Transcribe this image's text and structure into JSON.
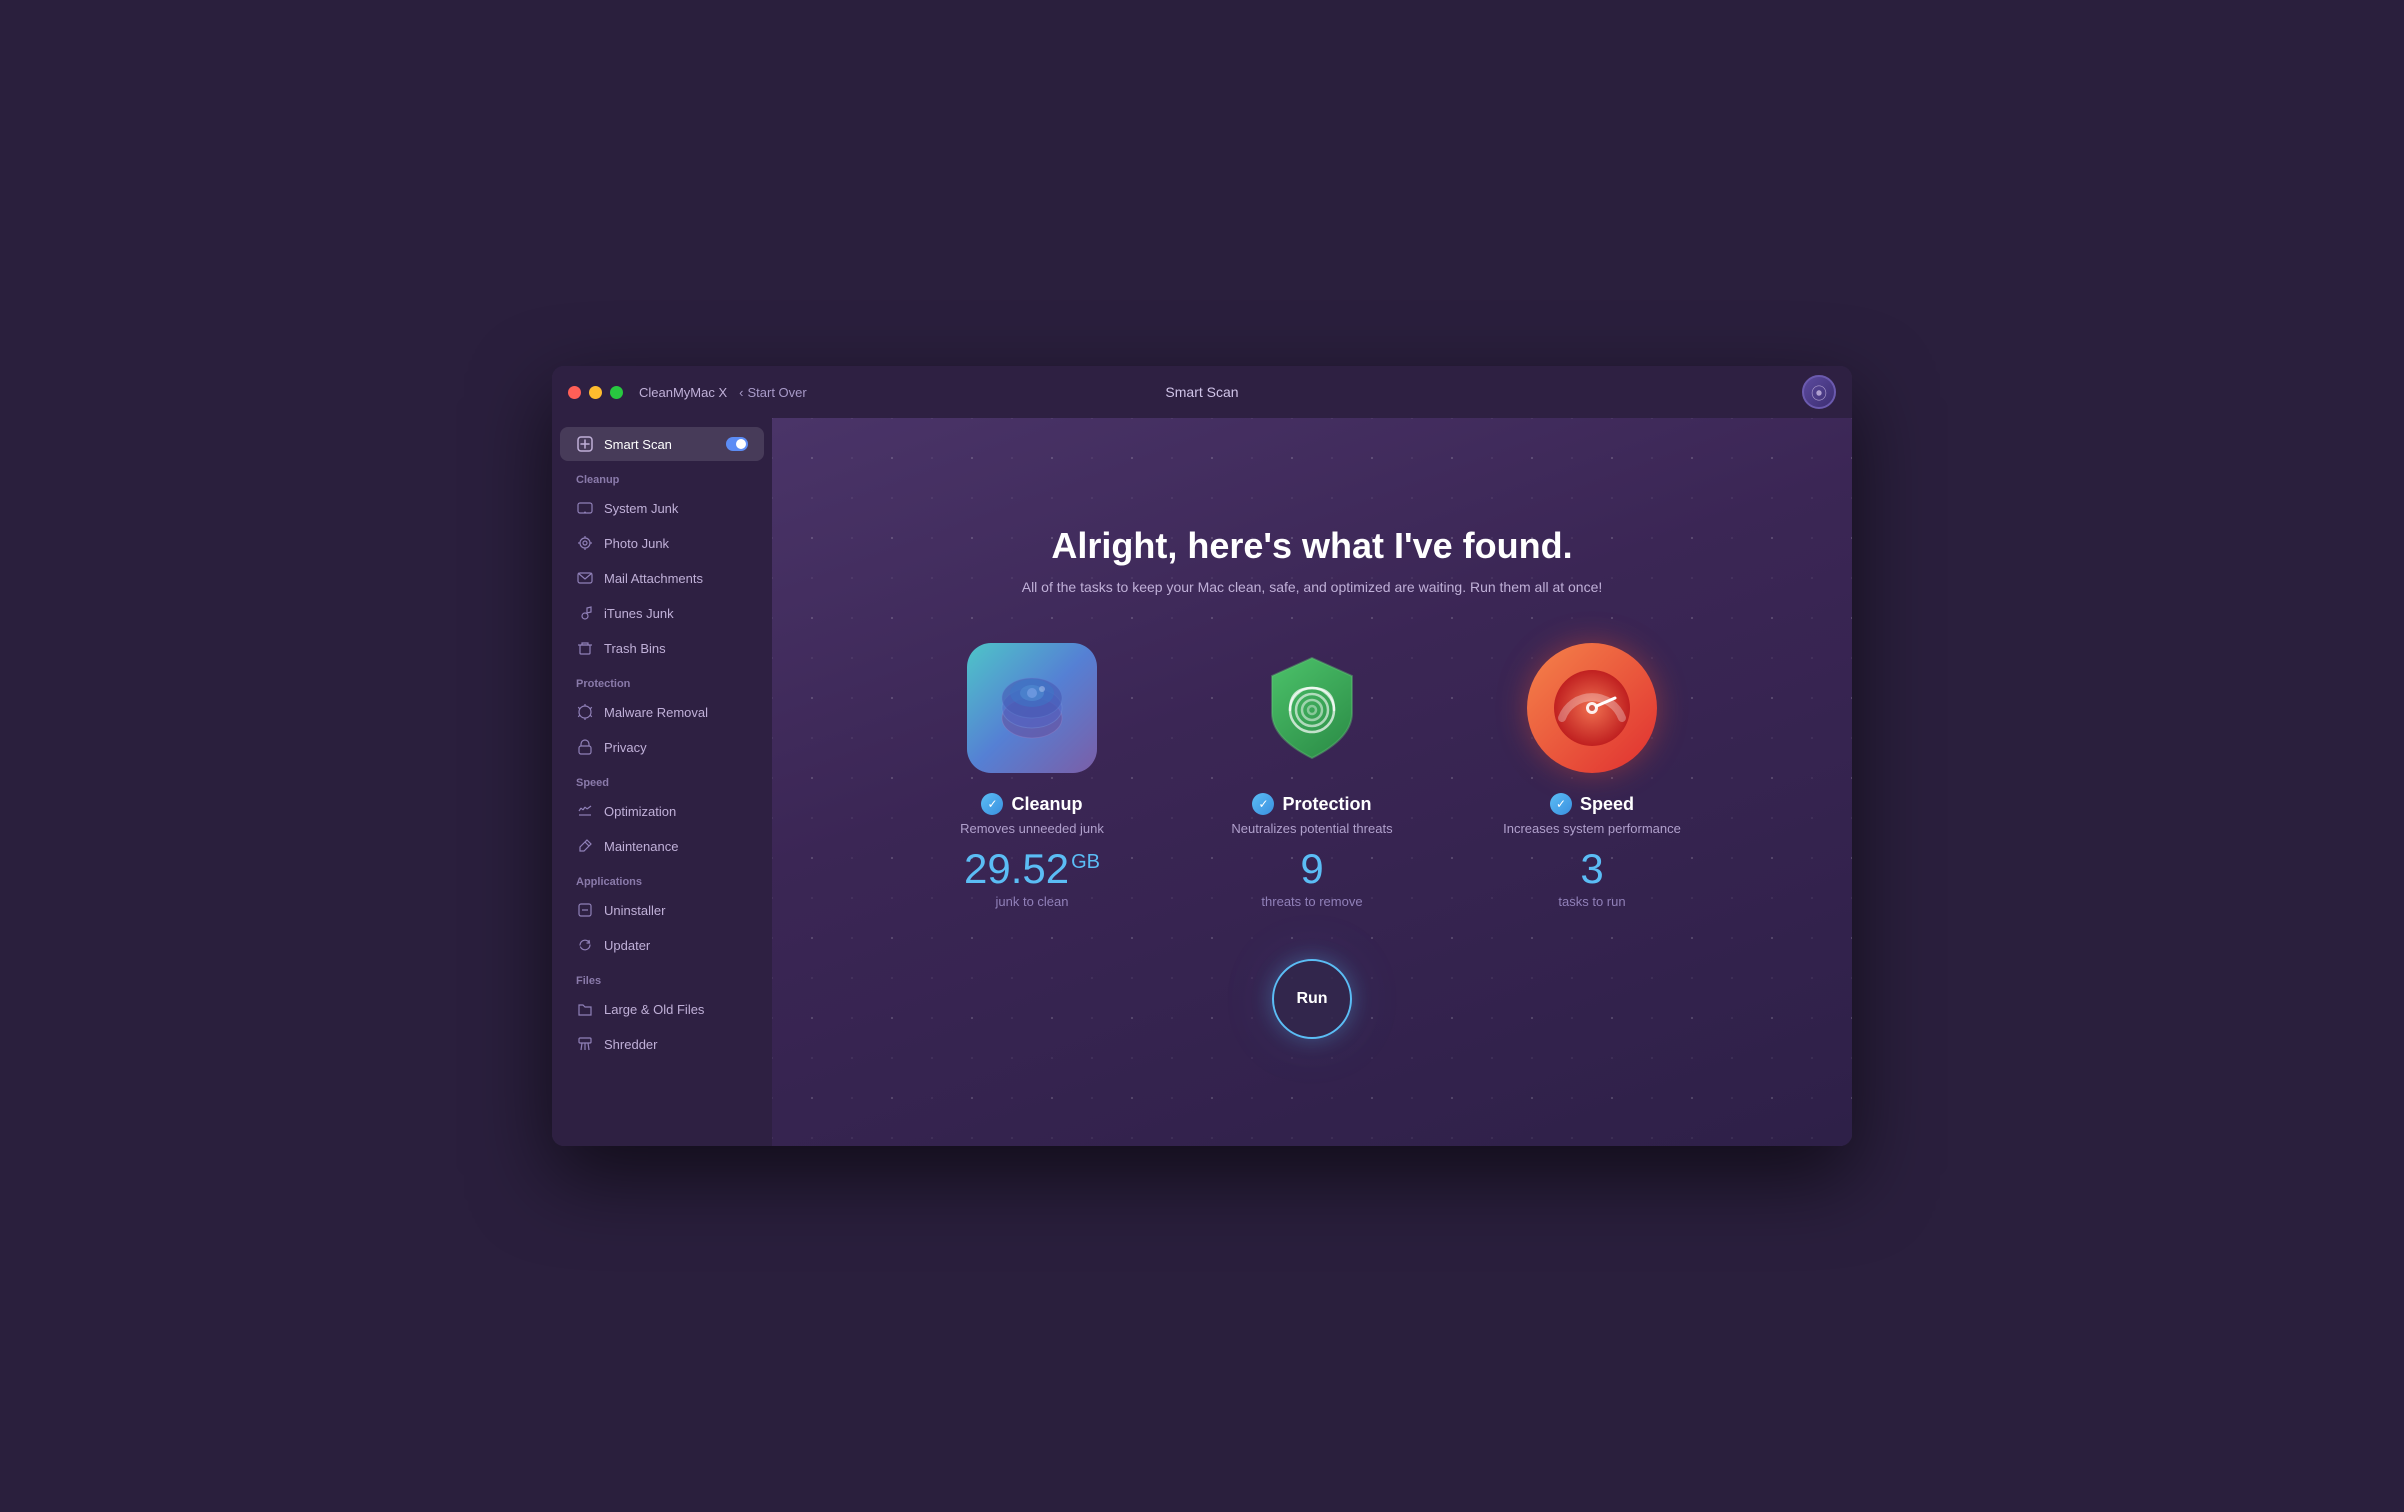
{
  "window": {
    "title": "CleanMyMac X",
    "center_title": "Smart Scan",
    "nav_back": "Start Over"
  },
  "sidebar": {
    "active_item": "smart-scan",
    "smart_scan_label": "Smart Scan",
    "sections": [
      {
        "id": "cleanup",
        "label": "Cleanup",
        "items": [
          {
            "id": "system-junk",
            "label": "System Junk",
            "icon": "🖥"
          },
          {
            "id": "photo-junk",
            "label": "Photo Junk",
            "icon": "✦"
          },
          {
            "id": "mail-attachments",
            "label": "Mail Attachments",
            "icon": "✉"
          },
          {
            "id": "itunes-junk",
            "label": "iTunes Junk",
            "icon": "♪"
          },
          {
            "id": "trash-bins",
            "label": "Trash Bins",
            "icon": "🗑"
          }
        ]
      },
      {
        "id": "protection",
        "label": "Protection",
        "items": [
          {
            "id": "malware-removal",
            "label": "Malware Removal",
            "icon": "☣"
          },
          {
            "id": "privacy",
            "label": "Privacy",
            "icon": "✋"
          }
        ]
      },
      {
        "id": "speed",
        "label": "Speed",
        "items": [
          {
            "id": "optimization",
            "label": "Optimization",
            "icon": "⚙"
          },
          {
            "id": "maintenance",
            "label": "Maintenance",
            "icon": "🔧"
          }
        ]
      },
      {
        "id": "applications",
        "label": "Applications",
        "items": [
          {
            "id": "uninstaller",
            "label": "Uninstaller",
            "icon": "⊠"
          },
          {
            "id": "updater",
            "label": "Updater",
            "icon": "↻"
          }
        ]
      },
      {
        "id": "files",
        "label": "Files",
        "items": [
          {
            "id": "large-old-files",
            "label": "Large & Old Files",
            "icon": "📁"
          },
          {
            "id": "shredder",
            "label": "Shredder",
            "icon": "⊟"
          }
        ]
      }
    ]
  },
  "content": {
    "headline": "Alright, here's what I've found.",
    "subheadline": "All of the tasks to keep your Mac clean, safe, and optimized are waiting. Run them all at once!",
    "cards": [
      {
        "id": "cleanup",
        "title": "Cleanup",
        "description": "Removes unneeded junk",
        "value": "29.52",
        "value_unit": "GB",
        "sublabel": "junk to clean"
      },
      {
        "id": "protection",
        "title": "Protection",
        "description": "Neutralizes potential threats",
        "value": "9",
        "value_unit": "",
        "sublabel": "threats to remove"
      },
      {
        "id": "speed",
        "title": "Speed",
        "description": "Increases system performance",
        "value": "3",
        "value_unit": "",
        "sublabel": "tasks to run"
      }
    ],
    "run_button_label": "Run"
  }
}
